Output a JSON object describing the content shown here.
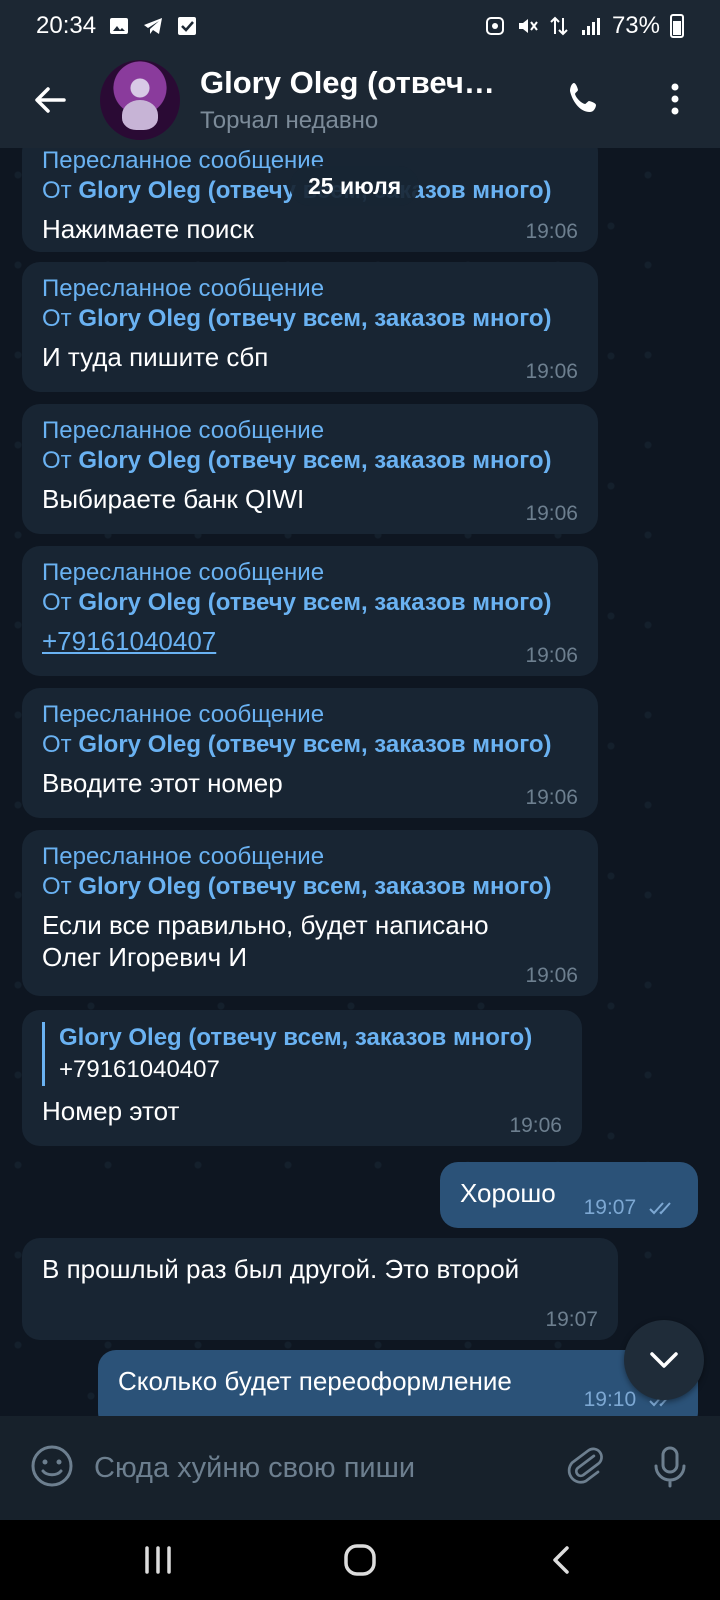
{
  "status_bar": {
    "time": "20:34",
    "battery": "73%",
    "icons": [
      "gallery-icon",
      "telegram-icon",
      "checkbox-icon",
      "recycle-icon",
      "mute-icon",
      "data-arrows-icon",
      "signal-icon",
      "battery-icon"
    ]
  },
  "header": {
    "title": "Glory Oleg (отвеч…",
    "subtitle": "Торчал недавно"
  },
  "date_pill": "25 июля",
  "forward_label": "Пересланное сообщение",
  "forward_from_prefix": "От",
  "forward_from_name": "Glory Oleg (отвечу всем, заказов много)",
  "messages": [
    {
      "text": "Нажимаете поиск",
      "time": "19:06"
    },
    {
      "text": "И туда пишите сбп",
      "time": "19:06"
    },
    {
      "text": "Выбираете банк QIWI",
      "time": "19:06"
    },
    {
      "text": "+79161040407",
      "time": "19:06"
    },
    {
      "text": "Вводите этот номер",
      "time": "19:06"
    },
    {
      "text_line1": "Если все правильно, будет написано",
      "text_line2": "Олег Игоревич И",
      "time": "19:06"
    }
  ],
  "reply_message": {
    "quote_name": "Glory Oleg (отвечу всем, заказов много)",
    "quote_text": "+79161040407",
    "text": "Номер этот",
    "time": "19:06"
  },
  "out_message_1": {
    "text": "Хорошо",
    "time": "19:07"
  },
  "in_message_plain": {
    "text": "В прошлый раз был другой. Это второй",
    "time": "19:07"
  },
  "out_message_2": {
    "text": "Сколько будет переоформление",
    "time": "19:10"
  },
  "input": {
    "placeholder": "Сюда хуйню свою пиши"
  },
  "colors": {
    "bg": "#0e1621",
    "incoming": "#182533",
    "outgoing": "#2b5278",
    "accent": "#6ab2f2"
  }
}
